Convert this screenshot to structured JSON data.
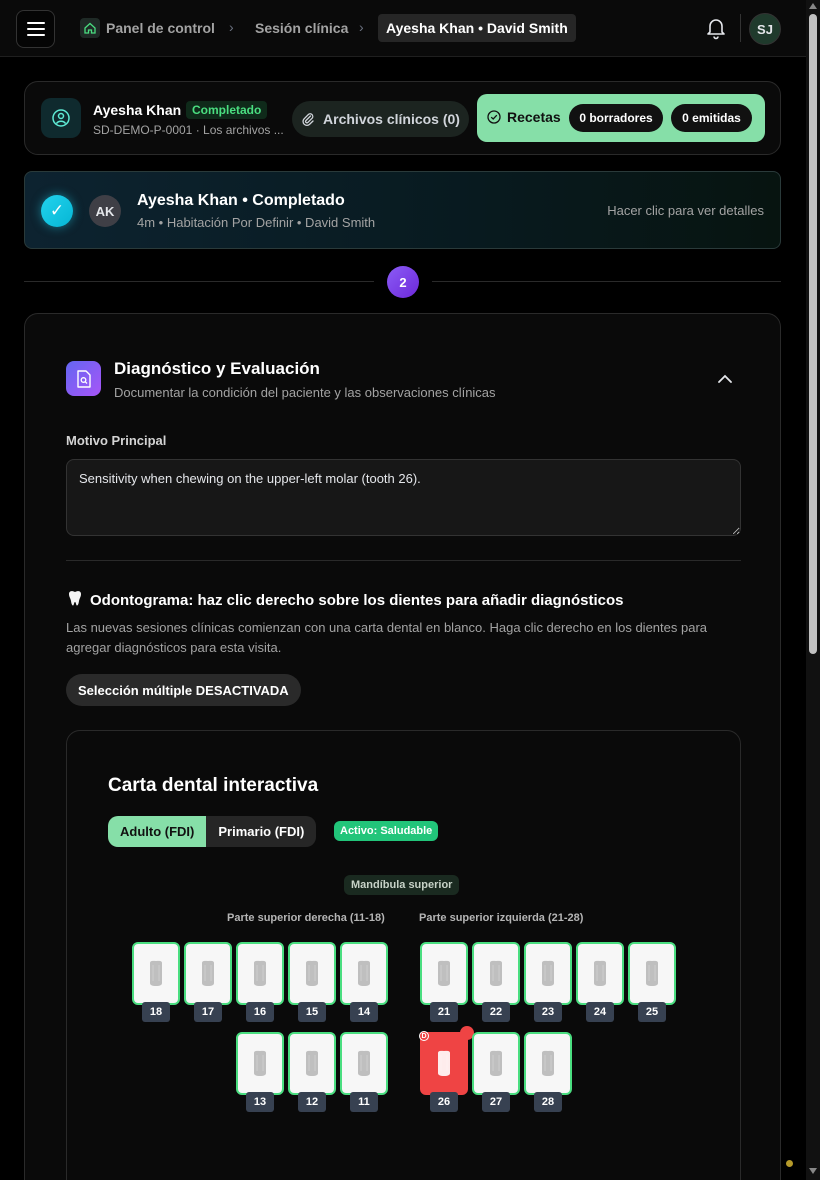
{
  "topbar": {
    "breadcrumb": [
      "Panel de control",
      "Sesión clínica",
      "Ayesha Khan • David Smith"
    ],
    "user_initials": "SJ"
  },
  "patient": {
    "name": "Ayesha Khan",
    "status": "Completado",
    "sub": "SD-DEMO-P-0001 · Los archivos ...",
    "files_label": "Archivos clínicos (0)",
    "rx_label": "Recetas",
    "rx_drafts": "0 borradores",
    "rx_issued": "0 emitidas"
  },
  "session": {
    "avatar": "AK",
    "title": "Ayesha Khan • Completado",
    "sub": "4m • Habitación Por Definir • David Smith",
    "hint": "Hacer clic para ver detalles"
  },
  "step": "2",
  "diagnosis": {
    "title": "Diagnóstico y Evaluación",
    "subtitle": "Documentar la condición del paciente y las observaciones clínicas",
    "field_label": "Motivo Principal",
    "field_value": "Sensitivity when chewing on the upper-left molar (tooth 26).",
    "odo_title": "Odontograma: haz clic derecho sobre los dientes para añadir diagnósticos",
    "odo_desc": "Las nuevas sesiones clínicas comienzan con una carta dental en blanco. Haga clic derecho en los dientes para agregar diagnósticos para esta visita.",
    "multi_select": "Selección múltiple DESACTIVADA"
  },
  "chart": {
    "title": "Carta dental interactiva",
    "tab_adult": "Adulto (FDI)",
    "tab_primary": "Primario (FDI)",
    "active_badge": "Activo: Saludable",
    "jaw": "Mandíbula superior",
    "quad_right": "Parte superior derecha (11-18)",
    "quad_left": "Parte superior izquierda (21-28)",
    "row1_right": [
      "18",
      "17",
      "16",
      "15",
      "14"
    ],
    "row1_left": [
      "21",
      "22",
      "23",
      "24",
      "25"
    ],
    "row2_right": [
      "13",
      "12",
      "11"
    ],
    "row2_left": [
      "26",
      "27",
      "28"
    ],
    "diagnosed_mark": "D"
  },
  "colors": {
    "accent_green": "#86dfa8",
    "healthy_border": "#4ade80",
    "diagnosed": "#ef4444",
    "step_purple": "#7c3aed"
  }
}
